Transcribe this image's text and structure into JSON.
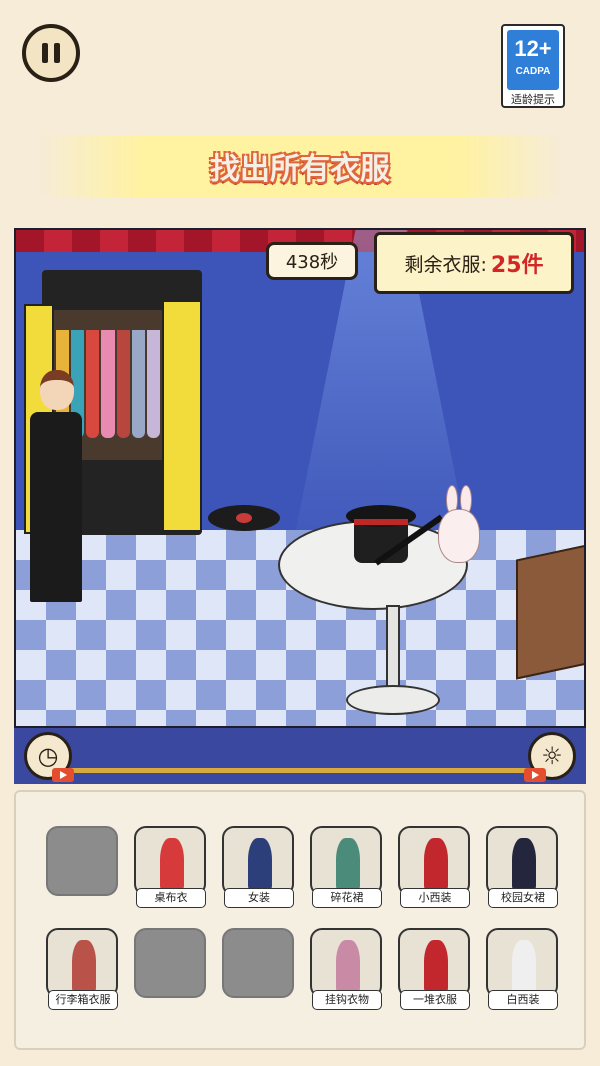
{
  "header": {
    "title": "找出所有衣服",
    "age_rating": {
      "number": "12+",
      "org": "CADPA",
      "hint": "适龄提示"
    }
  },
  "scene": {
    "timer": "438秒",
    "remaining_label": "剩余衣服:",
    "remaining_count": "25件"
  },
  "items": [
    {
      "label": "",
      "found": false
    },
    {
      "label": "桌布衣",
      "found": true,
      "color": "#d63a3a"
    },
    {
      "label": "女装",
      "found": true,
      "color": "#2d3f7a"
    },
    {
      "label": "碎花裙",
      "found": true,
      "color": "#4a8b7a"
    },
    {
      "label": "小西装",
      "found": true,
      "color": "#c2272d"
    },
    {
      "label": "校园女裙",
      "found": true,
      "color": "#23263d"
    },
    {
      "label": "行李箱衣服",
      "found": true,
      "color": "#b9534a"
    },
    {
      "label": "",
      "found": false
    },
    {
      "label": "",
      "found": false
    },
    {
      "label": "挂钩衣物",
      "found": true,
      "color": "#c98aa5"
    },
    {
      "label": "一堆衣服",
      "found": true,
      "color": "#c2272d"
    },
    {
      "label": "白西装",
      "found": true,
      "color": "#efefef"
    }
  ]
}
